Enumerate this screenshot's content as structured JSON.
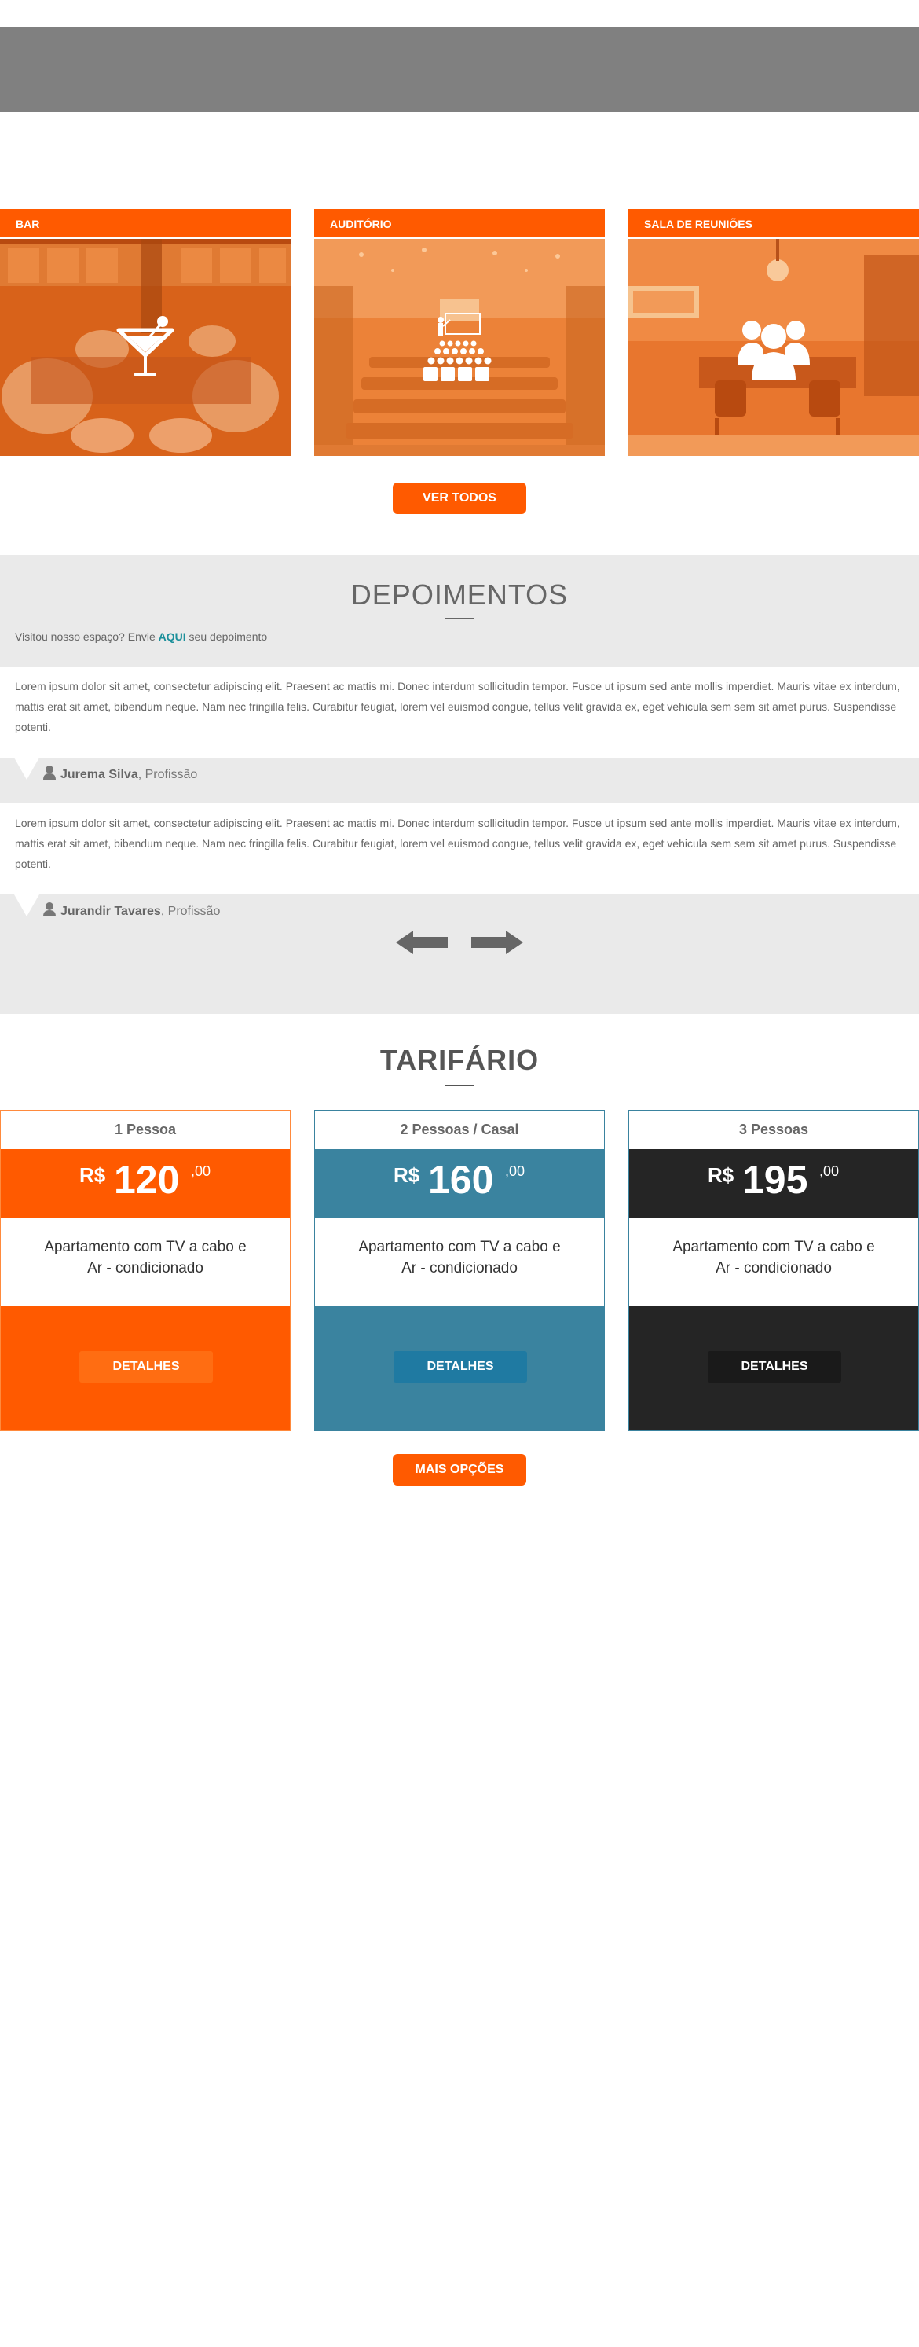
{
  "spaces": {
    "cards": [
      {
        "label": "BAR",
        "icon": "cocktail-icon"
      },
      {
        "label": "AUDITÓRIO",
        "icon": "auditorium-icon"
      },
      {
        "label": "SALA DE REUNIÕES",
        "icon": "people-icon"
      }
    ],
    "see_all_label": "VER TODOS"
  },
  "testimonials": {
    "title": "DEPOIMENTOS",
    "invite_prefix": "Visitou nosso espaço? Envie",
    "invite_link": "AQUI",
    "invite_suffix": "seu depoimento",
    "items": [
      {
        "text": "Lorem ipsum dolor sit amet, consectetur adipiscing elit. Praesent ac mattis mi. Donec interdum sollicitudin tempor. Fusce ut ipsum sed ante mollis imperdiet. Mauris vitae ex interdum, mattis erat sit amet, bibendum neque. Nam nec fringilla felis. Curabitur feugiat, lorem vel euismod congue, tellus velit gravida ex, eget vehicula sem sem sit amet purus. Suspendisse potenti.",
        "name": "Jurema Silva",
        "role": ", Profissão"
      },
      {
        "text": "Lorem ipsum dolor sit amet, consectetur adipiscing elit. Praesent ac mattis mi. Donec interdum sollicitudin tempor. Fusce ut ipsum sed ante mollis imperdiet. Mauris vitae ex interdum, mattis erat sit amet, bibendum neque. Nam nec fringilla felis. Curabitur feugiat, lorem vel euismod congue, tellus velit gravida ex, eget vehicula sem sem sit amet purus. Suspendisse potenti.",
        "name": "Jurandir Tavares",
        "role": ", Profissão"
      }
    ]
  },
  "pricing": {
    "title": "TARIFÁRIO",
    "plans": [
      {
        "name": "1 Pessoa",
        "currency": "R$",
        "amount": "120",
        "cents": ",00",
        "desc_line1": "Apartamento com TV a cabo e",
        "desc_line2": "Ar - condicionado",
        "button": "DETALHES",
        "color": "#ff5a00",
        "button_color": "#ff6d12"
      },
      {
        "name": "2 Pessoas / Casal",
        "currency": "R$",
        "amount": "160",
        "cents": ",00",
        "desc_line1": "Apartamento com TV a cabo e",
        "desc_line2": "Ar - condicionado",
        "button": "DETALHES",
        "color": "#3a839f",
        "button_color": "#1f7aa2"
      },
      {
        "name": "3 Pessoas",
        "currency": "R$",
        "amount": "195",
        "cents": ",00",
        "desc_line1": "Apartamento com TV a cabo e",
        "desc_line2": "Ar - condicionado",
        "button": "DETALHES",
        "color": "#252525",
        "button_color": "#1a1a1a"
      }
    ],
    "more_label": "MAIS OPÇÕES"
  }
}
